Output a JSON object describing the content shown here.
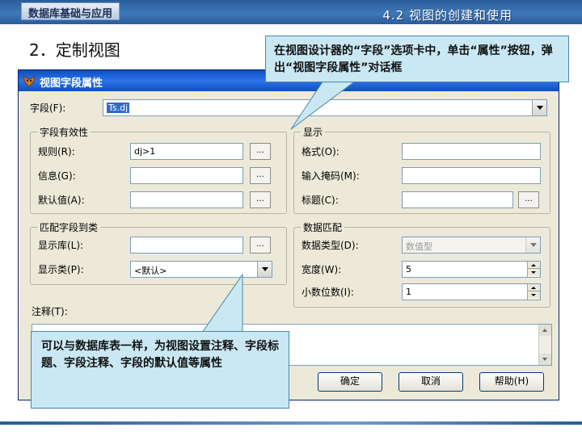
{
  "slide": {
    "header_tab": "数据库基础与应用",
    "section_title": "4.2 视图的创建和使用",
    "heading": "2．定制视图"
  },
  "dialog": {
    "title": "视图字段属性",
    "field_label": "字段(F):",
    "field_value": "Ts.dj",
    "validity": {
      "title": "字段有效性",
      "rule_label": "规则(R):",
      "rule_value": "dj>1",
      "message_label": "信息(G):",
      "message_value": "",
      "default_label": "默认值(A):",
      "default_value": "",
      "dots": "..."
    },
    "display": {
      "title": "显示",
      "format_label": "格式(O):",
      "format_value": "",
      "inputmask_label": "输入掩码(M):",
      "inputmask_value": "",
      "caption_label": "标题(C):",
      "caption_value": ""
    },
    "match_class": {
      "title": "匹配字段到类",
      "library_label": "显示库(L):",
      "library_value": "",
      "class_label": "显示类(P):",
      "class_value": "<默认>"
    },
    "data_match": {
      "title": "数据匹配",
      "type_label": "数据类型(D):",
      "type_value": "数值型",
      "width_label": "宽度(W):",
      "width_value": "5",
      "decimals_label": "小数位数(I):",
      "decimals_value": "1"
    },
    "comment_label": "注释(T):",
    "buttons": {
      "ok": "确定",
      "cancel": "取消",
      "help": "帮助(H)"
    }
  },
  "callouts": {
    "top": "在视图设计器的“字段”选项卡中，单击“属性”按钮，弹出“视图字段属性”对话框",
    "bottom": "可以与数据库表一样，为视图设置注释、字段标题、字段注释、字段的默认值等属性"
  },
  "colors": {
    "titlebar": "#0a4fc4",
    "dialog_bg": "#ece9d8",
    "callout_bg": "#c9e8f3",
    "header": "#2a5c9a"
  }
}
